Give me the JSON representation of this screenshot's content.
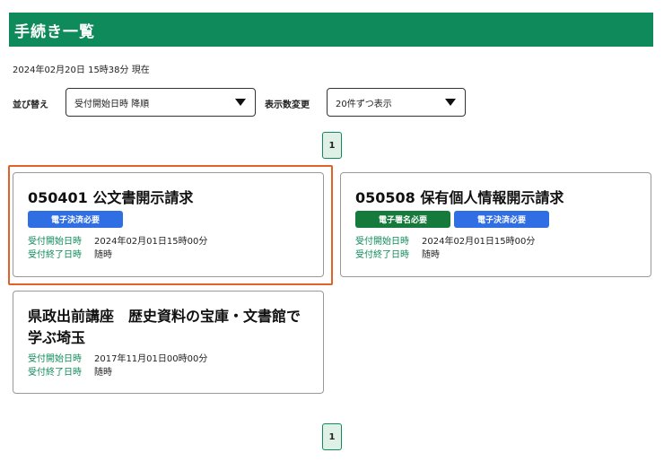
{
  "header": {
    "title": "手続き一覧"
  },
  "as_of": "2024年02月20日 15時38分 現在",
  "controls": {
    "sort_label": "並び替え",
    "sort_value": "受付開始日時 降順",
    "count_label": "表示数変更",
    "count_value": "20件ずつ表示"
  },
  "pagination": {
    "current_page": "1"
  },
  "cards": [
    {
      "title": "050401 公文書開示請求",
      "tags": [
        "電子決済必要"
      ],
      "start_label": "受付開始日時",
      "start_value": "2024年02月01日15時00分",
      "end_label": "受付終了日時",
      "end_value": "随時"
    },
    {
      "title": "050508 保有個人情報開示請求",
      "tags": [
        "電子署名必要",
        "電子決済必要"
      ],
      "start_label": "受付開始日時",
      "start_value": "2024年02月01日15時00分",
      "end_label": "受付終了日時",
      "end_value": "随時"
    },
    {
      "title": "県政出前講座　歴史資料の宝庫・文書館で学ぶ埼玉",
      "tags": [],
      "start_label": "受付開始日時",
      "start_value": "2017年11月01日00時00分",
      "end_label": "受付終了日時",
      "end_value": "随時"
    }
  ],
  "colors": {
    "header_bg": "#0f8a5a",
    "tag_blue": "#2f6ee3",
    "tag_green": "#157a3c",
    "highlight": "#e0622a"
  }
}
